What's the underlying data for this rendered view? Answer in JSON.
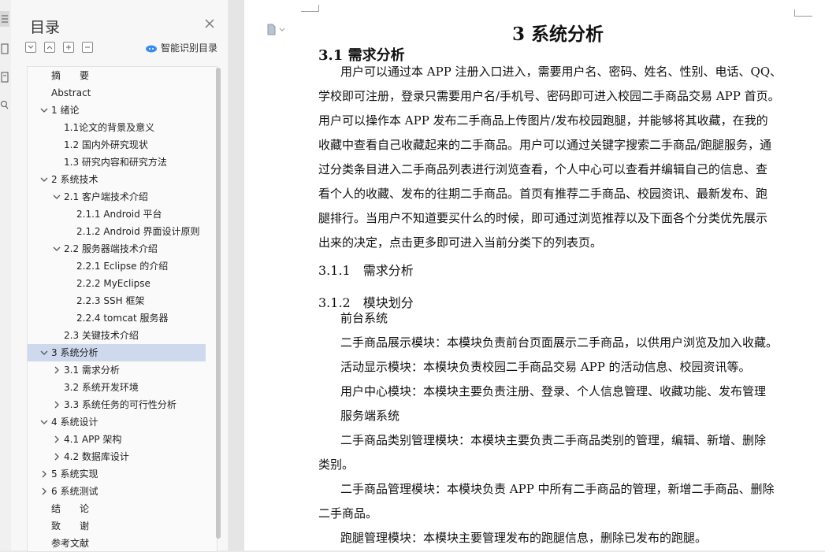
{
  "toc": {
    "title": "目录",
    "smart_label": "智能识别目录",
    "items": [
      {
        "label": "摘　　要",
        "level": 0,
        "chev": ""
      },
      {
        "label": "Abstract",
        "level": 0,
        "chev": ""
      },
      {
        "label": "1 绪论",
        "level": 0,
        "chev": "down"
      },
      {
        "label": "1.1论文的背景及意义",
        "level": 1,
        "chev": ""
      },
      {
        "label": "1.2 国内外研究现状",
        "level": 1,
        "chev": ""
      },
      {
        "label": "1.3  研究内容和研究方法",
        "level": 1,
        "chev": ""
      },
      {
        "label": "2 系统技术",
        "level": 0,
        "chev": "down"
      },
      {
        "label": "2.1 客户端技术介绍",
        "level": 1,
        "chev": "down"
      },
      {
        "label": "2.1.1 Android  平台",
        "level": 2,
        "chev": ""
      },
      {
        "label": "2.1.2 Android  界面设计原则",
        "level": 2,
        "chev": ""
      },
      {
        "label": "2.2 服务器端技术介绍",
        "level": 1,
        "chev": "down"
      },
      {
        "label": "2.2.1 Eclipse  的介绍",
        "level": 2,
        "chev": ""
      },
      {
        "label": "2.2.2 MyEclipse",
        "level": 2,
        "chev": ""
      },
      {
        "label": "2.2.3 SSH  框架",
        "level": 2,
        "chev": ""
      },
      {
        "label": "2.2.4 tomcat  服务器",
        "level": 2,
        "chev": ""
      },
      {
        "label": "2.3  关键技术介绍",
        "level": 1,
        "chev": ""
      },
      {
        "label": "3 系统分析",
        "level": 0,
        "chev": "down",
        "selected": true
      },
      {
        "label": "3.1 需求分析",
        "level": 1,
        "chev": "right"
      },
      {
        "label": "3.2    系统开发环境",
        "level": 1,
        "chev": ""
      },
      {
        "label": "3.3    系统任务的可行性分析",
        "level": 1,
        "chev": "right"
      },
      {
        "label": "4 系统设计",
        "level": 0,
        "chev": "down"
      },
      {
        "label": "4.1    APP 架构",
        "level": 1,
        "chev": "right"
      },
      {
        "label": "4.2    数据库设计",
        "level": 1,
        "chev": "right"
      },
      {
        "label": "5 系统实现",
        "level": 0,
        "chev": "right"
      },
      {
        "label": "6 系统测试",
        "level": 0,
        "chev": "right"
      },
      {
        "label": "结　　论",
        "level": 0,
        "chev": ""
      },
      {
        "label": "致　　谢",
        "level": 0,
        "chev": ""
      },
      {
        "label": "参考文献",
        "level": 0,
        "chev": ""
      }
    ]
  },
  "doc": {
    "h1": "3 系统分析",
    "h2": "3.1 需求分析",
    "lines": [
      {
        "t": "用户可以通过本 APP 注册入口进入，需要用户名、密码、姓名、性别、电话、QQ、",
        "indent": true
      },
      {
        "t": "学校即可注册，登录只需要用户名/手机号、密码即可进入校园二手商品交易 APP 首页。",
        "indent": false
      },
      {
        "t": "用户可以操作本 APP 发布二手商品上传图片/发布校园跑腿，并能够将其收藏，在我的",
        "indent": false
      },
      {
        "t": "收藏中查看自己收藏起来的二手商品。用户可以通过关键字搜索二手商品/跑腿服务，通",
        "indent": false
      },
      {
        "t": "过分类条目进入二手商品列表进行浏览查看，个人中心可以查看并编辑自己的信息、查",
        "indent": false
      },
      {
        "t": "看个人的收藏、发布的往期二手商品。首页有推荐二手商品、校园资讯、最新发布、跑",
        "indent": false
      },
      {
        "t": "腿排行。当用户不知道要买什么的时候，即可通过浏览推荐以及下面各个分类优先展示",
        "indent": false
      },
      {
        "t": "出来的决定，点击更多即可进入当前分类下的列表页。",
        "indent": false
      }
    ],
    "h3a": "3.1.1　需求分析",
    "h3b": "3.1.2　模块划分",
    "lines2": [
      {
        "t": "前台系统",
        "indent": true
      },
      {
        "t": "二手商品展示模块：本模块负责前台页面展示二手商品，以供用户浏览及加入收藏。",
        "indent": true
      },
      {
        "t": "活动显示模块：本模块负责校园二手商品交易 APP 的活动信息、校园资讯等。",
        "indent": true
      },
      {
        "t": "用户中心模块：本模块主要负责注册、登录、个人信息管理、收藏功能、发布管理",
        "indent": true
      },
      {
        "t": "服务端系统",
        "indent": true
      },
      {
        "t": "二手商品类别管理模块：本模块主要负责二手商品类别的管理，编辑、新增、删除",
        "indent": true
      },
      {
        "t": "类别。",
        "indent": false
      },
      {
        "t": "二手商品管理模块：本模块负责 APP 中所有二手商品的管理，新增二手商品、删除",
        "indent": true
      },
      {
        "t": "二手商品。",
        "indent": false
      },
      {
        "t": "跑腿管理模块：本模块主要管理发布的跑腿信息，删除已发布的跑腿。",
        "indent": true
      }
    ]
  }
}
